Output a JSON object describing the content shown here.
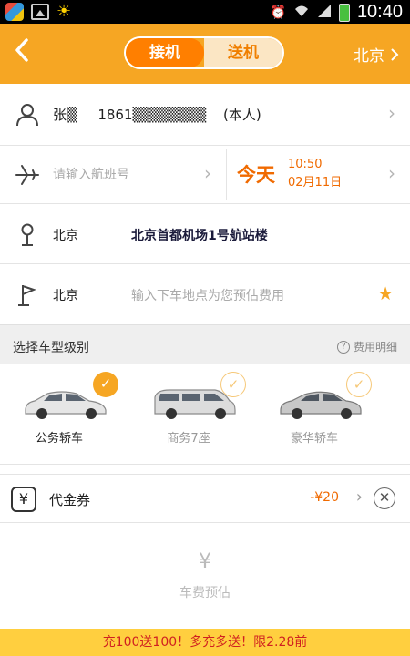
{
  "status_bar": {
    "time": "10:40",
    "icons": [
      "app-icon",
      "gallery-icon",
      "sun-icon",
      "alarm-icon",
      "wifi-icon",
      "signal-icon",
      "battery-icon"
    ]
  },
  "header": {
    "back_icon": "chevron-left-icon",
    "tabs": [
      {
        "label": "接机",
        "active": true
      },
      {
        "label": "送机",
        "active": false
      }
    ],
    "city": "北京"
  },
  "passenger": {
    "name": "张▒",
    "phone": "1861▒▒▒▒▒▒▒",
    "tag": "(本人)"
  },
  "flight": {
    "placeholder": "请输入航班号",
    "day": "今天",
    "time": "10:50",
    "date": "02月11日"
  },
  "pickup": {
    "city": "北京",
    "address": "北京首都机场1号航站楼"
  },
  "dropoff": {
    "city": "北京",
    "placeholder": "输入下车地点为您预估费用"
  },
  "car_section": {
    "title": "选择车型级别",
    "help_label": "费用明细"
  },
  "cars": [
    {
      "name": "公务轿车",
      "selected": true
    },
    {
      "name": "商务7座",
      "selected": false
    },
    {
      "name": "豪华轿车",
      "selected": false
    }
  ],
  "voucher": {
    "label": "代金券",
    "amount": "-¥20"
  },
  "estimate": {
    "symbol": "¥",
    "label": "车费预估"
  },
  "promo": {
    "text": "充100送100！多充多送！限2.28前"
  },
  "colors": {
    "accent": "#f6a623",
    "accent_dark": "#ff7f00",
    "promo_bg": "#ffcf3f"
  }
}
